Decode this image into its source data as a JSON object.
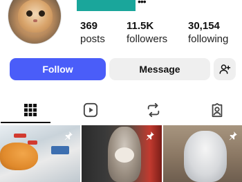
{
  "profile": {
    "stats": [
      {
        "value": "369",
        "label": "posts"
      },
      {
        "value": "11.5K",
        "label": "followers"
      },
      {
        "value": "30,154",
        "label": "following"
      }
    ]
  },
  "actions": {
    "follow_label": "Follow",
    "message_label": "Message",
    "suggest_icon": "add-person-icon"
  },
  "tabs": [
    {
      "icon": "grid-icon",
      "active": true
    },
    {
      "icon": "reels-icon",
      "active": false
    },
    {
      "icon": "reposts-icon",
      "active": false
    },
    {
      "icon": "tagged-icon",
      "active": false
    }
  ],
  "grid": {
    "tiles": [
      {
        "subject": "orange cat on fish counter",
        "pinned": true
      },
      {
        "subject": "tabby cat",
        "pinned": true
      },
      {
        "subject": "gray and white kitten",
        "pinned": true
      }
    ]
  },
  "colors": {
    "follow_button": "#4a5df9",
    "secondary_button": "#efefef",
    "name_bar": "#1aa69b"
  }
}
